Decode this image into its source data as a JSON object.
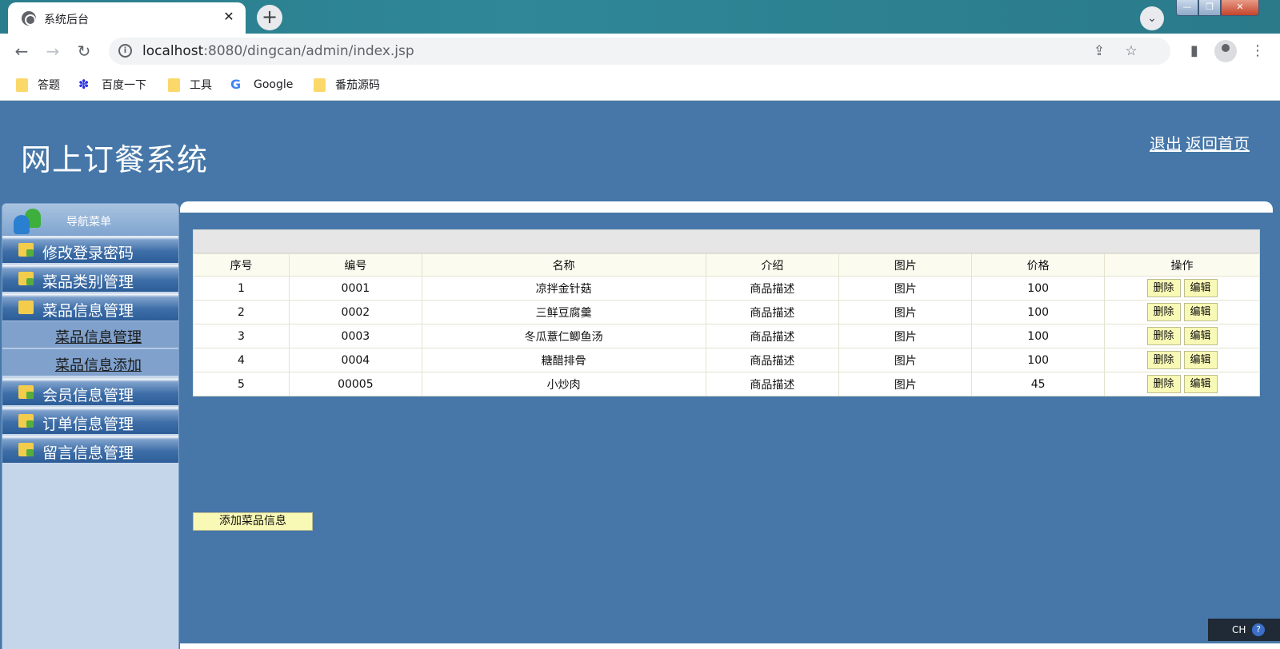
{
  "browser": {
    "tab_title": "系统后台",
    "url_host": "localhost",
    "url_path": ":8080/dingcan/admin/index.jsp",
    "bookmarks": [
      {
        "label": "答题",
        "icon": "folder-icon"
      },
      {
        "label": "百度一下",
        "icon": "baidu-icon"
      },
      {
        "label": "工具",
        "icon": "folder-icon"
      },
      {
        "label": "Google",
        "icon": "google-icon"
      },
      {
        "label": "番茄源码",
        "icon": "folder-icon"
      }
    ]
  },
  "header": {
    "site_title": "网上订餐系统",
    "logout_label": "退出",
    "home_label": "返回首页"
  },
  "sidebar": {
    "header_label": "导航菜单",
    "items": [
      {
        "label": "修改登录密码"
      },
      {
        "label": "菜品类别管理"
      },
      {
        "label": "菜品信息管理"
      },
      {
        "label": "会员信息管理"
      },
      {
        "label": "订单信息管理"
      },
      {
        "label": "留言信息管理"
      }
    ],
    "sub_items": [
      {
        "label": "菜品信息管理"
      },
      {
        "label": "菜品信息添加"
      }
    ]
  },
  "table": {
    "columns": [
      "序号",
      "编号",
      "名称",
      "介绍",
      "图片",
      "价格",
      "操作"
    ],
    "rows": [
      [
        "1",
        "0001",
        "凉拌金针菇",
        "商品描述",
        "图片",
        "100"
      ],
      [
        "2",
        "0002",
        "三鲜豆腐羹",
        "商品描述",
        "图片",
        "100"
      ],
      [
        "3",
        "0003",
        "冬瓜薏仁鲫鱼汤",
        "商品描述",
        "图片",
        "100"
      ],
      [
        "4",
        "0004",
        "糖醋排骨",
        "商品描述",
        "图片",
        "100"
      ],
      [
        "5",
        "00005",
        "小炒肉",
        "商品描述",
        "图片",
        "45"
      ]
    ],
    "delete_label": "删除",
    "edit_label": "编辑"
  },
  "add_button_label": "添加菜品信息",
  "ime": {
    "label": "CH"
  },
  "colors": {
    "page_bg": "#4677a8",
    "button_bg": "#f9f9b6",
    "sidebar_bg": "#c6d6ea"
  }
}
